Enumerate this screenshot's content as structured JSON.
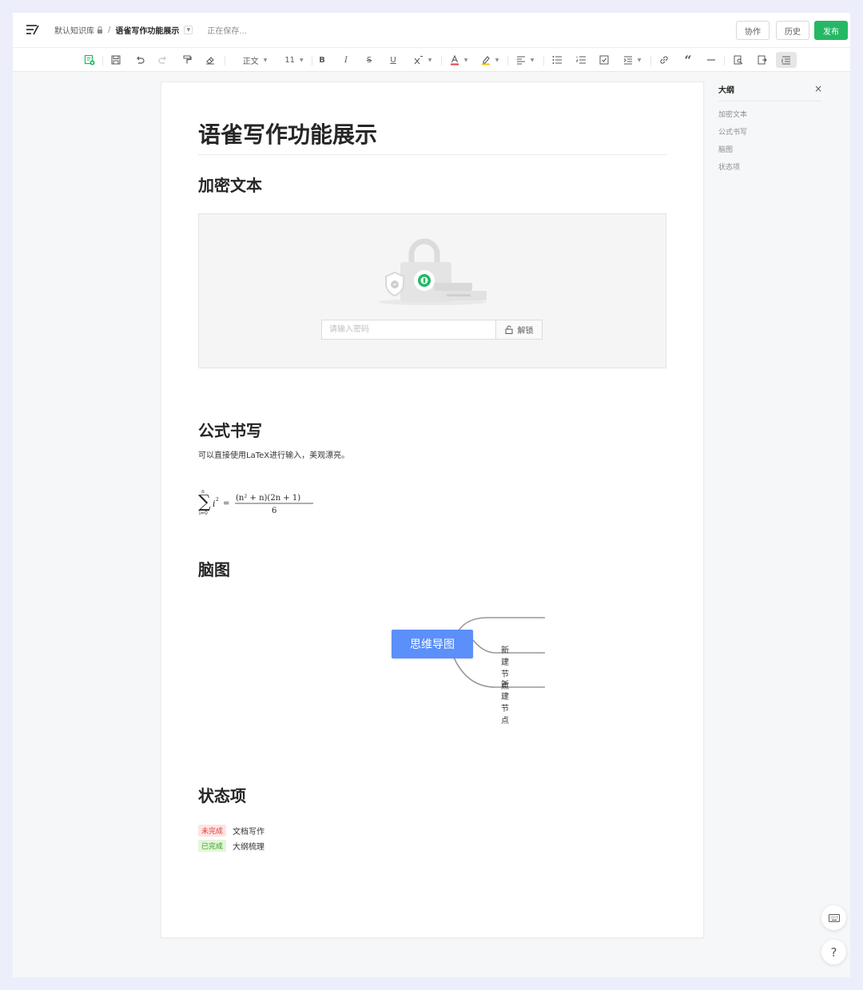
{
  "header": {
    "repo": "默认知识库",
    "separator": "/",
    "doc_title": "语雀写作功能展示",
    "saving": "正在保存...",
    "collab_label": "协作",
    "history_label": "历史",
    "publish_label": "发布"
  },
  "toolbar": {
    "style_label": "正文",
    "font_size": "11"
  },
  "doc": {
    "title": "语雀写作功能展示",
    "sections": {
      "encrypt": {
        "heading": "加密文本",
        "password_placeholder": "请输入密码",
        "unlock_label": "解锁"
      },
      "formula": {
        "heading": "公式书写",
        "description": "可以直接使用LaTeX进行输入，美观漂亮。",
        "latex": "\\sum_{i=0}^{n} i^2 = \\frac{(n^2+n)(2n+1)}{6}"
      },
      "mindmap": {
        "heading": "脑图",
        "root": "思维导图",
        "nodes": [
          "新建节点",
          "新建节点"
        ]
      },
      "status": {
        "heading": "状态项",
        "items": [
          {
            "badge": "未完成",
            "text": "文档写作"
          },
          {
            "badge": "已完成",
            "text": "大纲梳理"
          }
        ]
      }
    }
  },
  "outline": {
    "title": "大纲",
    "close": "×",
    "items": [
      "加密文本",
      "公式书写",
      "脑图",
      "状态项"
    ]
  },
  "colors": {
    "publish": "#25b864",
    "mind_root": "#5b8ff9",
    "todo": "#e0403d",
    "done": "#3b9c29"
  }
}
